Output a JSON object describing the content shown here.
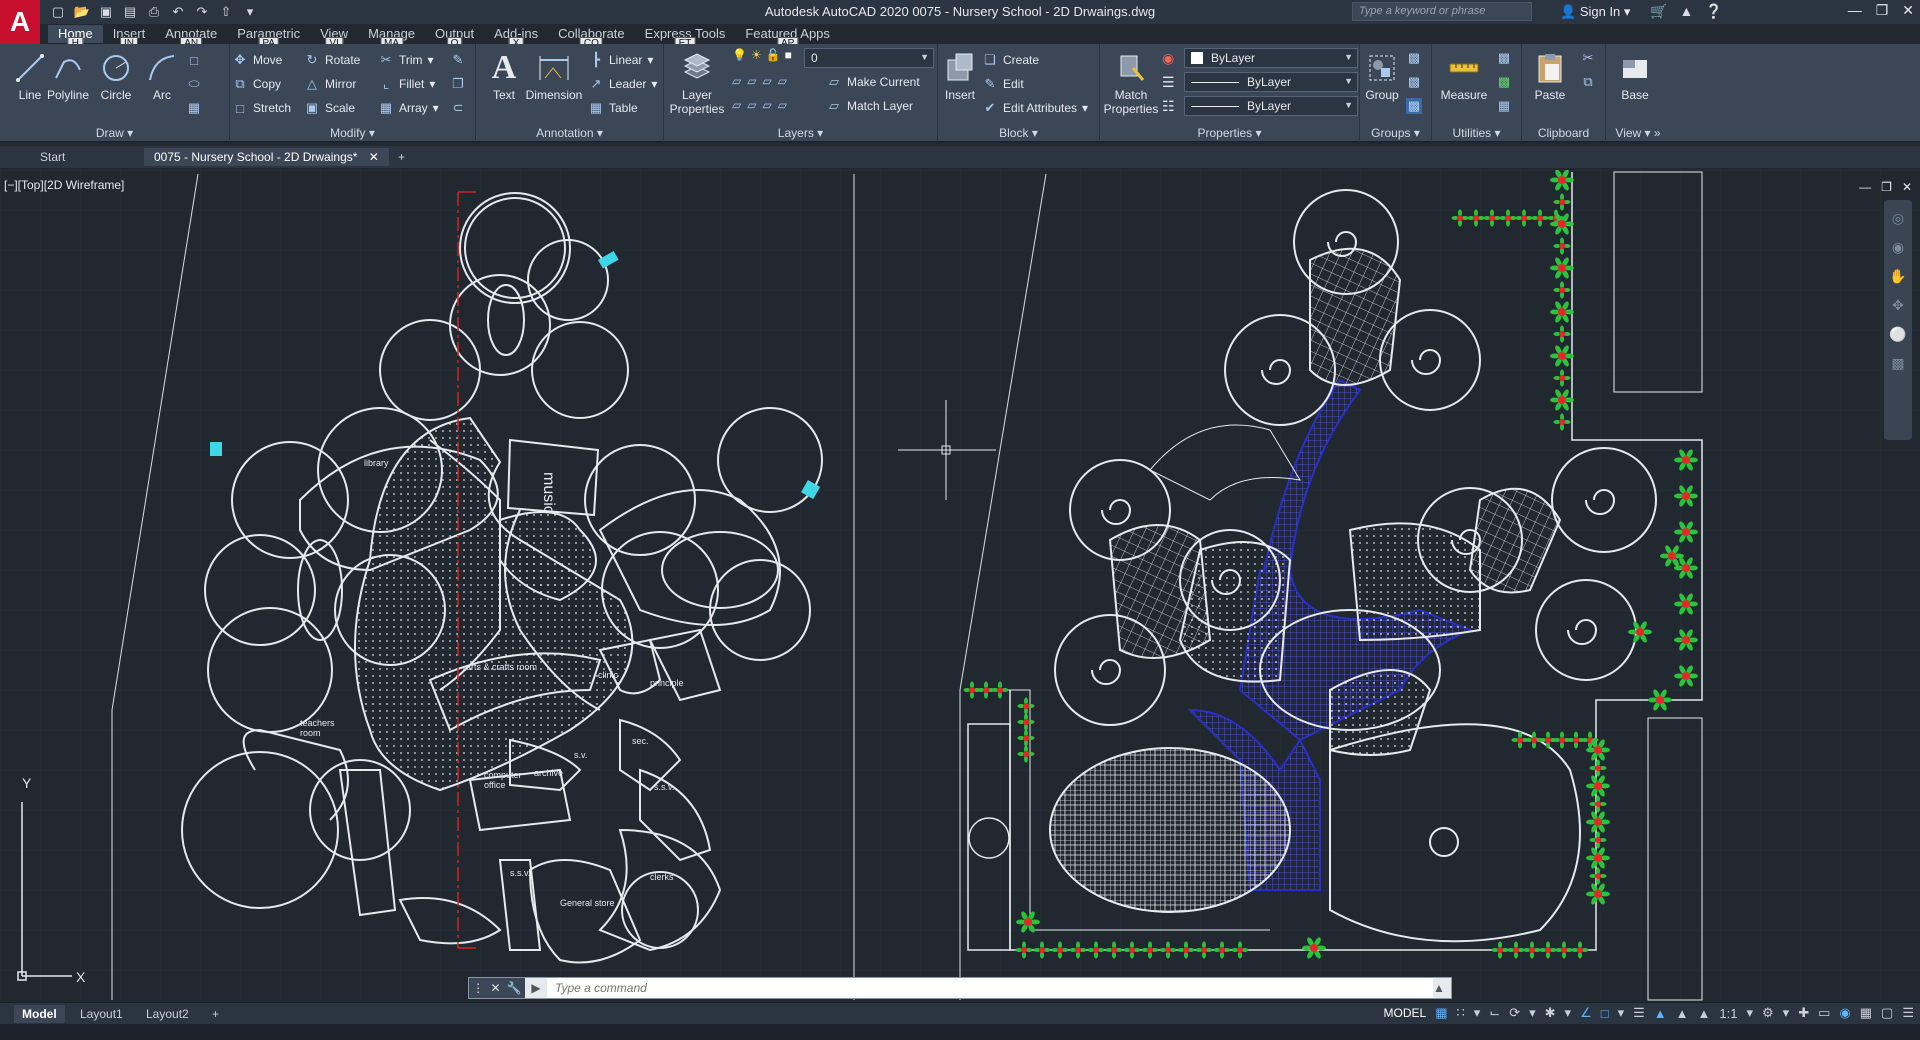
{
  "app": {
    "title": "Autodesk AutoCAD 2020   0075 - Nursery School - 2D Drwaings.dwg",
    "logo": "A",
    "search_placeholder": "Type a keyword or phrase",
    "signin": "Sign In",
    "accent": "#c8102e"
  },
  "ribbon_tabs": [
    {
      "label": "Home",
      "keytip": "H",
      "active": true
    },
    {
      "label": "Insert",
      "keytip": "IN"
    },
    {
      "label": "Annotate",
      "keytip": "AN"
    },
    {
      "label": "Parametric",
      "keytip": "PA"
    },
    {
      "label": "View",
      "keytip": "VI"
    },
    {
      "label": "Manage",
      "keytip": "MA"
    },
    {
      "label": "Output",
      "keytip": "O"
    },
    {
      "label": "Add-ins",
      "keytip": "X"
    },
    {
      "label": "Collaborate",
      "keytip": "CO"
    },
    {
      "label": "Express Tools",
      "keytip": "ET"
    },
    {
      "label": "Featured Apps",
      "keytip": "AP"
    }
  ],
  "panels": {
    "draw": {
      "title": "Draw",
      "line": "Line",
      "polyline": "Polyline",
      "circle": "Circle",
      "arc": "Arc"
    },
    "modify": {
      "title": "Modify",
      "move": "Move",
      "rotate": "Rotate",
      "trim": "Trim",
      "copy": "Copy",
      "mirror": "Mirror",
      "fillet": "Fillet",
      "stretch": "Stretch",
      "scale": "Scale",
      "array": "Array"
    },
    "annotation": {
      "title": "Annotation",
      "text": "Text",
      "dimension": "Dimension",
      "linear": "Linear",
      "leader": "Leader",
      "table": "Table"
    },
    "layers": {
      "title": "Layers",
      "layer_properties": "Layer Properties",
      "current_layer": "0",
      "make_current": "Make Current",
      "match_layer": "Match Layer"
    },
    "block": {
      "title": "Block",
      "insert": "Insert",
      "create": "Create",
      "edit": "Edit",
      "edit_attributes": "Edit Attributes"
    },
    "properties": {
      "title": "Properties",
      "match_properties": "Match Properties",
      "color": "ByLayer",
      "linetype": "ByLayer",
      "lineweight": "ByLayer"
    },
    "groups": {
      "title": "Groups",
      "group": "Group"
    },
    "utilities": {
      "title": "Utilities",
      "measure": "Measure"
    },
    "clipboard": {
      "title": "Clipboard",
      "paste": "Paste"
    },
    "view": {
      "title": "View",
      "base": "Base"
    }
  },
  "doc_tabs": [
    {
      "label": "Start"
    },
    {
      "label": "0075 - Nursery School - 2D Drwaings*",
      "active": true
    }
  ],
  "viewport": {
    "label": "[−][Top][2D Wireframe]"
  },
  "drawing_labels": {
    "library": "library",
    "music": "music",
    "arts": "arts & crafts room",
    "clinic": "clinic",
    "principle": "principle",
    "teachers": "teachers",
    "room": "room",
    "computer": "computer",
    "office": "office",
    "archive": "archive",
    "sec": "sec.",
    "sv": "s.v.",
    "ssv1": "s.s.v.",
    "ssv2": "s.s.v.",
    "clerks": "clerks",
    "store": "General store"
  },
  "command_line": {
    "placeholder": "Type a command"
  },
  "layout_tabs": [
    {
      "label": "Model",
      "active": true
    },
    {
      "label": "Layout1"
    },
    {
      "label": "Layout2"
    }
  ],
  "status": {
    "model": "MODEL",
    "scale": "1:1"
  },
  "ucs": {
    "x": "X",
    "y": "Y"
  },
  "colors": {
    "hatch_blue": "#2a2fc7",
    "plant_red": "#e8262a",
    "plant_green": "#29c43a",
    "section_line": "#d42222",
    "cyan_detail": "#3fd6e6"
  }
}
